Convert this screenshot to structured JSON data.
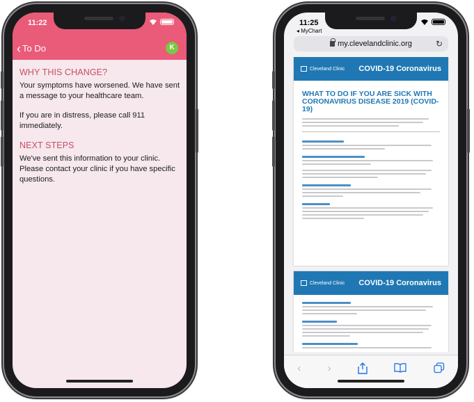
{
  "left_phone": {
    "status_time": "11:22",
    "nav": {
      "back_label": "To Do",
      "avatar_initial": "K"
    },
    "sections": [
      {
        "heading": "WHY THIS CHANGE?",
        "paragraphs": [
          "Your symptoms have worsened. We have sent a message to your healthcare team.",
          "If you are in distress, please call 911 immediately."
        ]
      },
      {
        "heading": "NEXT STEPS",
        "paragraphs": [
          "We've sent this information to your clinic. Please contact your clinic if you have specific questions."
        ]
      }
    ],
    "colors": {
      "header": "#ea5a79",
      "heading_text": "#c84d67",
      "avatar": "#7ac943",
      "background": "#f6e8ec"
    }
  },
  "right_phone": {
    "status_time": "11:25",
    "back_app": "MyChart",
    "url": "my.clevelandclinic.org",
    "document": {
      "brand": "Cleveland Clinic",
      "banner_title": "COVID-19 Coronavirus",
      "title": "WHAT TO DO IF YOU ARE SICK WITH CORONAVIRUS DISEASE 2019 (COVID-19)"
    },
    "toolbar_icons": [
      "back-arrow-icon",
      "forward-arrow-icon",
      "share-icon",
      "bookmarks-icon",
      "tabs-icon"
    ],
    "colors": {
      "banner": "#1f78b4",
      "link": "#1a73e8"
    }
  }
}
